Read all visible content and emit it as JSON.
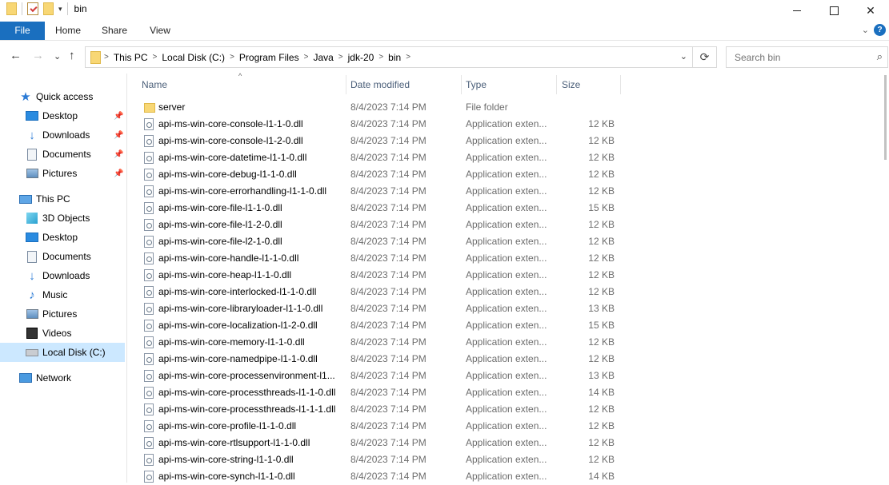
{
  "window": {
    "title": "bin",
    "qat_dropdown": "▾",
    "minimize_label": "",
    "close_label": "✕"
  },
  "ribbon": {
    "tabs": [
      "File",
      "Home",
      "Share",
      "View"
    ],
    "expand_label": "⌄",
    "help_label": "?",
    "file_color": "#1a6fbf"
  },
  "nav": {
    "back": "←",
    "forward": "→",
    "recent": "⌄",
    "up": "↑",
    "breadcrumb": [
      "This PC",
      "Local Disk (C:)",
      "Program Files",
      "Java",
      "jdk-20",
      "bin"
    ],
    "crumb_separator": ">",
    "address_dropdown": "⌄",
    "refresh": "⟳",
    "search_placeholder": "Search bin",
    "search_icon": "⌕"
  },
  "sidebar": {
    "pin_symbol": "📌",
    "quick_access": {
      "label": "Quick access",
      "items": [
        {
          "label": "Desktop",
          "icon": "desktop-icon",
          "pinned": true
        },
        {
          "label": "Downloads",
          "icon": "downloads-icon",
          "pinned": true
        },
        {
          "label": "Documents",
          "icon": "documents-icon",
          "pinned": true
        },
        {
          "label": "Pictures",
          "icon": "pictures-icon",
          "pinned": true
        }
      ]
    },
    "this_pc": {
      "label": "This PC",
      "items": [
        {
          "label": "3D Objects",
          "icon": "3d-objects-icon"
        },
        {
          "label": "Desktop",
          "icon": "desktop-icon"
        },
        {
          "label": "Documents",
          "icon": "documents-icon"
        },
        {
          "label": "Downloads",
          "icon": "downloads-icon"
        },
        {
          "label": "Music",
          "icon": "music-icon"
        },
        {
          "label": "Pictures",
          "icon": "pictures-icon"
        },
        {
          "label": "Videos",
          "icon": "videos-icon"
        },
        {
          "label": "Local Disk (C:)",
          "icon": "local-disk-icon",
          "selected": true
        }
      ]
    },
    "network": {
      "label": "Network"
    },
    "selection_color": "#cce8ff"
  },
  "columns": {
    "name": "Name",
    "date": "Date modified",
    "type": "Type",
    "size": "Size",
    "sort_indicator": "^"
  },
  "files": [
    {
      "name": "server",
      "date": "8/4/2023 7:14 PM",
      "type": "File folder",
      "size": "",
      "kind": "folder"
    },
    {
      "name": "api-ms-win-core-console-l1-1-0.dll",
      "date": "8/4/2023 7:14 PM",
      "type": "Application exten...",
      "size": "12 KB",
      "kind": "dll"
    },
    {
      "name": "api-ms-win-core-console-l1-2-0.dll",
      "date": "8/4/2023 7:14 PM",
      "type": "Application exten...",
      "size": "12 KB",
      "kind": "dll"
    },
    {
      "name": "api-ms-win-core-datetime-l1-1-0.dll",
      "date": "8/4/2023 7:14 PM",
      "type": "Application exten...",
      "size": "12 KB",
      "kind": "dll"
    },
    {
      "name": "api-ms-win-core-debug-l1-1-0.dll",
      "date": "8/4/2023 7:14 PM",
      "type": "Application exten...",
      "size": "12 KB",
      "kind": "dll"
    },
    {
      "name": "api-ms-win-core-errorhandling-l1-1-0.dll",
      "date": "8/4/2023 7:14 PM",
      "type": "Application exten...",
      "size": "12 KB",
      "kind": "dll"
    },
    {
      "name": "api-ms-win-core-file-l1-1-0.dll",
      "date": "8/4/2023 7:14 PM",
      "type": "Application exten...",
      "size": "15 KB",
      "kind": "dll"
    },
    {
      "name": "api-ms-win-core-file-l1-2-0.dll",
      "date": "8/4/2023 7:14 PM",
      "type": "Application exten...",
      "size": "12 KB",
      "kind": "dll"
    },
    {
      "name": "api-ms-win-core-file-l2-1-0.dll",
      "date": "8/4/2023 7:14 PM",
      "type": "Application exten...",
      "size": "12 KB",
      "kind": "dll"
    },
    {
      "name": "api-ms-win-core-handle-l1-1-0.dll",
      "date": "8/4/2023 7:14 PM",
      "type": "Application exten...",
      "size": "12 KB",
      "kind": "dll"
    },
    {
      "name": "api-ms-win-core-heap-l1-1-0.dll",
      "date": "8/4/2023 7:14 PM",
      "type": "Application exten...",
      "size": "12 KB",
      "kind": "dll"
    },
    {
      "name": "api-ms-win-core-interlocked-l1-1-0.dll",
      "date": "8/4/2023 7:14 PM",
      "type": "Application exten...",
      "size": "12 KB",
      "kind": "dll"
    },
    {
      "name": "api-ms-win-core-libraryloader-l1-1-0.dll",
      "date": "8/4/2023 7:14 PM",
      "type": "Application exten...",
      "size": "13 KB",
      "kind": "dll"
    },
    {
      "name": "api-ms-win-core-localization-l1-2-0.dll",
      "date": "8/4/2023 7:14 PM",
      "type": "Application exten...",
      "size": "15 KB",
      "kind": "dll"
    },
    {
      "name": "api-ms-win-core-memory-l1-1-0.dll",
      "date": "8/4/2023 7:14 PM",
      "type": "Application exten...",
      "size": "12 KB",
      "kind": "dll"
    },
    {
      "name": "api-ms-win-core-namedpipe-l1-1-0.dll",
      "date": "8/4/2023 7:14 PM",
      "type": "Application exten...",
      "size": "12 KB",
      "kind": "dll"
    },
    {
      "name": "api-ms-win-core-processenvironment-l1...",
      "date": "8/4/2023 7:14 PM",
      "type": "Application exten...",
      "size": "13 KB",
      "kind": "dll"
    },
    {
      "name": "api-ms-win-core-processthreads-l1-1-0.dll",
      "date": "8/4/2023 7:14 PM",
      "type": "Application exten...",
      "size": "14 KB",
      "kind": "dll"
    },
    {
      "name": "api-ms-win-core-processthreads-l1-1-1.dll",
      "date": "8/4/2023 7:14 PM",
      "type": "Application exten...",
      "size": "12 KB",
      "kind": "dll"
    },
    {
      "name": "api-ms-win-core-profile-l1-1-0.dll",
      "date": "8/4/2023 7:14 PM",
      "type": "Application exten...",
      "size": "12 KB",
      "kind": "dll"
    },
    {
      "name": "api-ms-win-core-rtlsupport-l1-1-0.dll",
      "date": "8/4/2023 7:14 PM",
      "type": "Application exten...",
      "size": "12 KB",
      "kind": "dll"
    },
    {
      "name": "api-ms-win-core-string-l1-1-0.dll",
      "date": "8/4/2023 7:14 PM",
      "type": "Application exten...",
      "size": "12 KB",
      "kind": "dll"
    },
    {
      "name": "api-ms-win-core-synch-l1-1-0.dll",
      "date": "8/4/2023 7:14 PM",
      "type": "Application exten...",
      "size": "14 KB",
      "kind": "dll"
    }
  ]
}
